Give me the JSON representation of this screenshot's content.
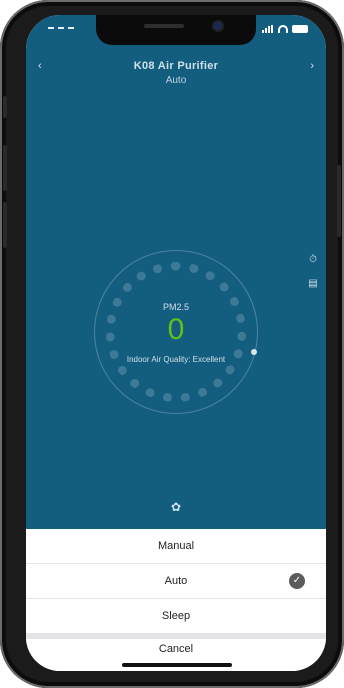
{
  "app": {
    "title": "K08 Air Purifier",
    "current_mode": "Auto"
  },
  "air": {
    "pm_label": "PM2.5",
    "pm_value": "0",
    "quality_label": "Indoor Air Quality: Excellent"
  },
  "mode_sheet": {
    "options": [
      {
        "label": "Manual",
        "selected": false
      },
      {
        "label": "Auto",
        "selected": true
      },
      {
        "label": "Sleep",
        "selected": false
      }
    ],
    "cancel_label": "Cancel"
  },
  "colors": {
    "app_background": "#135d7f",
    "pm_value_color": "#62bf1a",
    "sheet_background": "#ffffff"
  },
  "icons": {
    "nav_back": "back-chevron-icon",
    "nav_more": "more-icon",
    "side_timer": "timer-icon",
    "side_filter": "filter-icon",
    "fan": "fan-icon",
    "selected_check": "check-icon"
  }
}
